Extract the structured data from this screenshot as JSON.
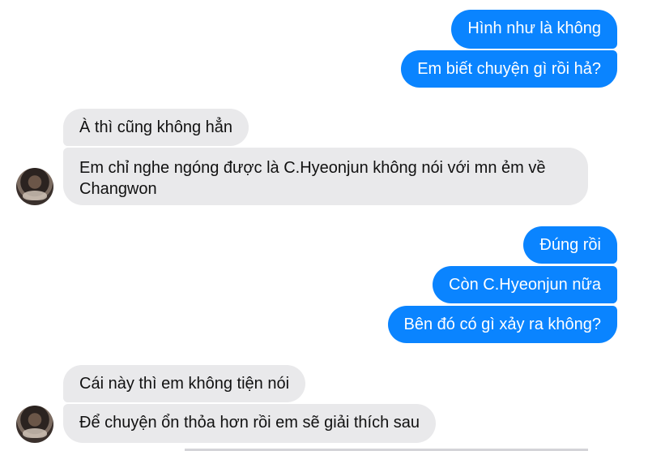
{
  "messages": [
    {
      "id": "o1",
      "direction": "outgoing",
      "text": "Hình như là không"
    },
    {
      "id": "o2",
      "direction": "outgoing",
      "text": "Em biết chuyện gì rồi hả?"
    },
    {
      "id": "i1",
      "direction": "incoming",
      "text": "À thì cũng không hẳn"
    },
    {
      "id": "i2",
      "direction": "incoming",
      "text": "Em chỉ nghe ngóng được là C.Hyeonjun không nói với mn ẻm về Changwon"
    },
    {
      "id": "o3",
      "direction": "outgoing",
      "text": "Đúng rồi"
    },
    {
      "id": "o4",
      "direction": "outgoing",
      "text": "Còn C.Hyeonjun nữa"
    },
    {
      "id": "o5",
      "direction": "outgoing",
      "text": "Bên đó có gì xảy ra không?"
    },
    {
      "id": "i3",
      "direction": "incoming",
      "text": "Cái này thì em không tiện nói"
    },
    {
      "id": "i4",
      "direction": "incoming",
      "text": "Để chuyện ổn thỏa hơn rồi em sẽ giải thích sau"
    }
  ],
  "colors": {
    "outgoing_bubble": "#0A84FF",
    "incoming_bubble": "#E9E9EB",
    "background": "#FFFFFF"
  }
}
